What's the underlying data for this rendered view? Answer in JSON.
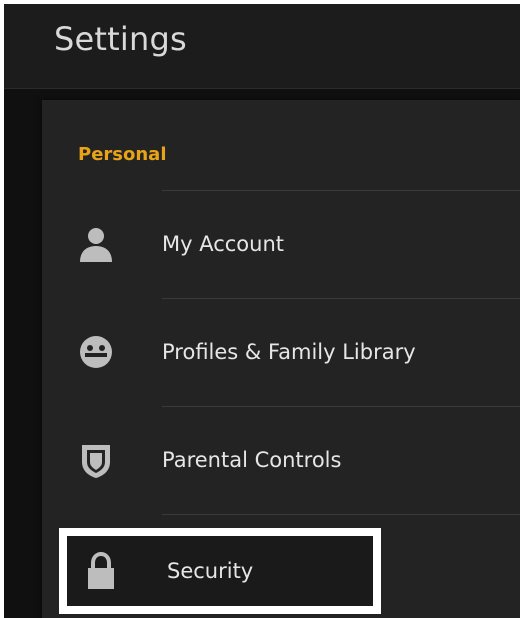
{
  "header": {
    "title": "Settings"
  },
  "section": {
    "label": "Personal"
  },
  "items": [
    {
      "label": "My Account",
      "icon": "person-icon"
    },
    {
      "label": "Profiles & Family Library",
      "icon": "smiley-face-icon"
    },
    {
      "label": "Parental Controls",
      "icon": "shield-icon"
    },
    {
      "label": "Security",
      "icon": "lock-icon"
    }
  ],
  "colors": {
    "accent": "#e8a317",
    "background": "#101010",
    "panel": "#232323",
    "text": "#e6e6e6",
    "icon": "#bdbdbd",
    "highlight_border": "#ffffff"
  }
}
